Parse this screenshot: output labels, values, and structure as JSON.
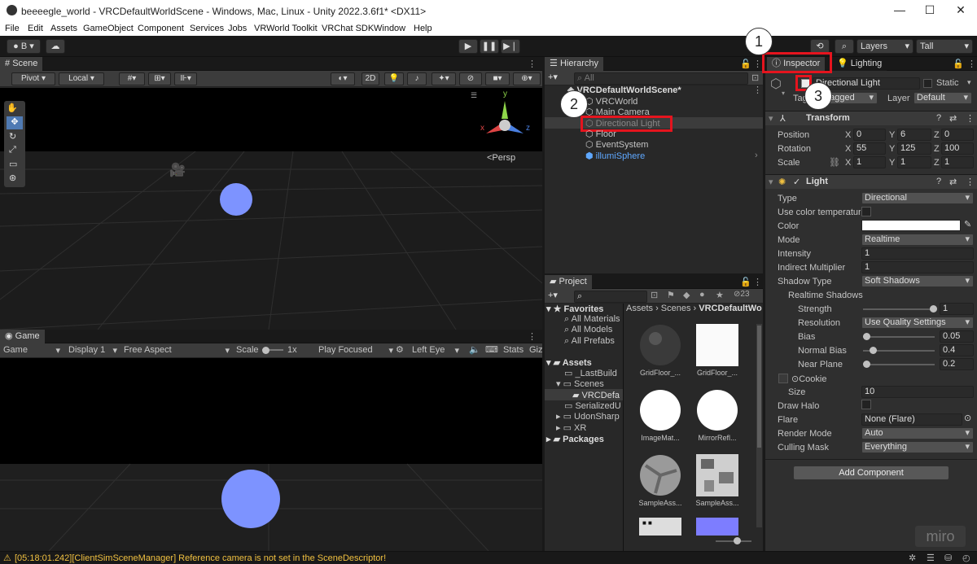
{
  "window": {
    "title": "beeeegle_world - VRCDefaultWorldScene - Windows, Mac, Linux - Unity 2022.3.6f1* <DX11>",
    "min": "—",
    "max": "☐",
    "close": "✕"
  },
  "menu": [
    "File",
    "Edit",
    "Assets",
    "GameObject",
    "Component",
    "Services",
    "Jobs",
    "VRWorld Toolkit",
    "VRChat SDK",
    "Window",
    "Help"
  ],
  "toolbar": {
    "account": "B",
    "layers": "Layers",
    "layout": "Tall"
  },
  "scene": {
    "tab": "Scene",
    "pivot": "Pivot",
    "local": "Local",
    "mode2d": "2D",
    "persp": "<Persp",
    "axes": {
      "x": "x",
      "y": "y",
      "z": "z"
    }
  },
  "game": {
    "tab": "Game",
    "display_mode": "Game",
    "display": "Display 1",
    "aspect": "Free Aspect",
    "scale_label": "Scale",
    "scale_value": "1x",
    "play_focus": "Play Focused",
    "eye": "Left Eye",
    "stats": "Stats",
    "gizmos": "Giz"
  },
  "hierarchy": {
    "tab": "Hierarchy",
    "search_placeholder": "All",
    "scene_name": "VRCDefaultWorldScene*",
    "items": [
      "VRCWorld",
      "Main Camera",
      "Directional Light",
      "Floor",
      "EventSystem",
      "illumiSphere"
    ]
  },
  "project": {
    "tab": "Project",
    "favorites_label": "Favorites",
    "favorites": [
      "All Materials",
      "All Models",
      "All Prefabs"
    ],
    "assets_label": "Assets",
    "folders": [
      "_LastBuild",
      "Scenes",
      "VRCDefa",
      "SerializedU",
      "UdonSharp",
      "XR"
    ],
    "packages_label": "Packages",
    "breadcrumb": [
      "Assets",
      "Scenes",
      "VRCDefaultWo"
    ],
    "hidden_count": "23",
    "assets": [
      "GridFloor_...",
      "GridFloor_...",
      "ImageMat...",
      "MirrorRefl...",
      "SampleAss...",
      "SampleAss...",
      "",
      ""
    ]
  },
  "inspector": {
    "tab": "Inspector",
    "tab2": "Lighting",
    "object_name": "Directional Light",
    "static_label": "Static",
    "tag_label": "Tag",
    "tag_value": "Untagged",
    "layer_label": "Layer",
    "layer_value": "Default",
    "transform": {
      "title": "Transform",
      "rows": [
        {
          "label": "Position",
          "x": "0",
          "y": "6",
          "z": "0"
        },
        {
          "label": "Rotation",
          "x": "55",
          "y": "125",
          "z": "100"
        },
        {
          "label": "Scale",
          "x": "1",
          "y": "1",
          "z": "1"
        }
      ]
    },
    "light": {
      "title": "Light",
      "type_label": "Type",
      "type_value": "Directional",
      "colortemp_label": "Use color temperature",
      "color_label": "Color",
      "mode_label": "Mode",
      "mode_value": "Realtime",
      "intensity_label": "Intensity",
      "intensity_value": "1",
      "indirect_label": "Indirect Multiplier",
      "indirect_value": "1",
      "shadow_label": "Shadow Type",
      "shadow_value": "Soft Shadows",
      "realtime_shadows": "Realtime Shadows",
      "strength_label": "Strength",
      "strength_value": "1",
      "resolution_label": "Resolution",
      "resolution_value": "Use Quality Settings",
      "bias_label": "Bias",
      "bias_value": "0.05",
      "normalbias_label": "Normal Bias",
      "normalbias_value": "0.4",
      "nearplane_label": "Near Plane",
      "nearplane_value": "0.2",
      "cookie_label": "Cookie",
      "size_label": "Size",
      "size_value": "10",
      "halo_label": "Draw Halo",
      "flare_label": "Flare",
      "flare_value": "None (Flare)",
      "render_label": "Render Mode",
      "render_value": "Auto",
      "culling_label": "Culling Mask",
      "culling_value": "Everything"
    },
    "add_component": "Add Component"
  },
  "callouts": [
    "1",
    "2",
    "3"
  ],
  "status": {
    "message": "[05:18:01.242][ClientSimSceneManager] Reference camera is not set in the SceneDescriptor!"
  },
  "watermark": "miro",
  "colors": {
    "accent": "#e5141e",
    "sphere": "#7d93ff",
    "selected": "#2c5d87"
  }
}
